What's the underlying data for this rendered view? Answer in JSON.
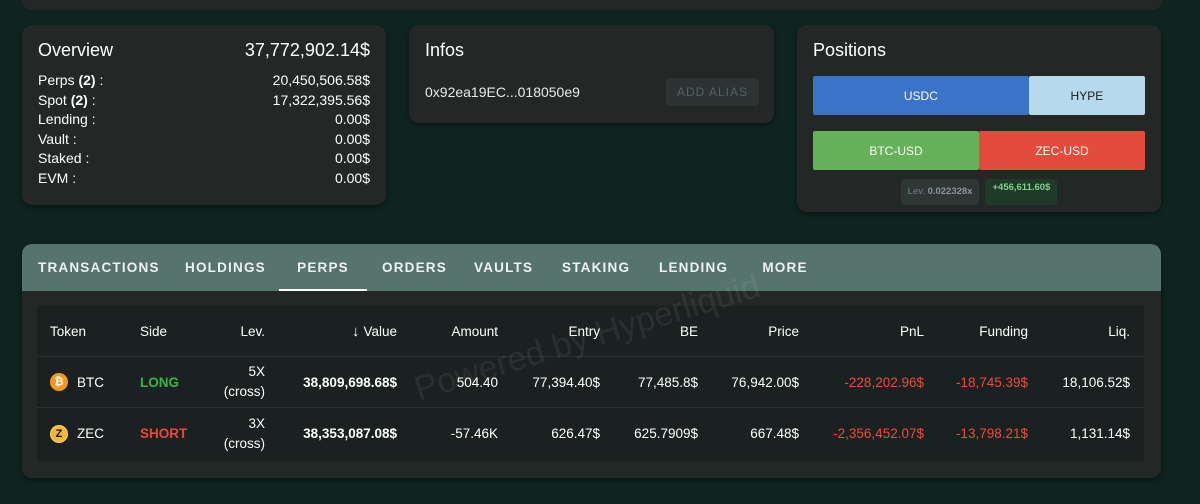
{
  "overview": {
    "title": "Overview",
    "total": "37,772,902.14$",
    "rows": [
      {
        "label": "Perps",
        "count": "(2)",
        "suffix": " :",
        "value": "20,450,506.58$"
      },
      {
        "label": "Spot",
        "count": "(2)",
        "suffix": " :",
        "value": "17,322,395.56$"
      },
      {
        "label": "Lending :",
        "count": "",
        "suffix": "",
        "value": "0.00$"
      },
      {
        "label": "Vault :",
        "count": "",
        "suffix": "",
        "value": "0.00$"
      },
      {
        "label": "Staked :",
        "count": "",
        "suffix": "",
        "value": "0.00$"
      },
      {
        "label": "EVM :",
        "count": "",
        "suffix": "",
        "value": "0.00$"
      }
    ]
  },
  "infos": {
    "title": "Infos",
    "address": "0x92ea19EC...018050e9",
    "add_alias_label": "ADD ALIAS"
  },
  "positions": {
    "title": "Positions",
    "collateral_bar": [
      {
        "label": "USDC",
        "share": 0.65,
        "bg": "#3b73c9",
        "fg": "#ffffff"
      },
      {
        "label": "HYPE",
        "share": 0.35,
        "bg": "#b7d9ec",
        "fg": "#1a1a1a"
      }
    ],
    "side_bar": [
      {
        "label": "BTC-USD",
        "share": 0.5,
        "bg": "#66b25a",
        "fg": "#ffffff"
      },
      {
        "label": "ZEC-USD",
        "share": 0.5,
        "bg": "#e34b3c",
        "fg": "#ffffff"
      }
    ],
    "leverage_label": "Lev.",
    "leverage_value": "0.022328x",
    "pnl": "+456,611.60$"
  },
  "tabs": [
    "TRANSACTIONS",
    "HOLDINGS",
    "PERPS",
    "ORDERS",
    "VAULTS",
    "STAKING",
    "LENDING",
    "MORE"
  ],
  "active_tab": "PERPS",
  "table": {
    "headers": {
      "token": "Token",
      "side": "Side",
      "lev": "Lev.",
      "value": "Value",
      "amount": "Amount",
      "entry": "Entry",
      "be": "BE",
      "price": "Price",
      "pnl": "PnL",
      "funding": "Funding",
      "liq": "Liq."
    },
    "sort_indicator": "↓",
    "rows": [
      {
        "icon": "bitcoin-icon",
        "icon_glyph": "₿",
        "token": "BTC",
        "side": "LONG",
        "lev": "5X",
        "lev_mode": "(cross)",
        "value": "38,809,698.68$",
        "amount": "504.40",
        "entry": "77,394.40$",
        "be": "77,485.8$",
        "price": "76,942.00$",
        "pnl": "-228,202.96$",
        "funding": "-18,745.39$",
        "liq": "18,106.52$"
      },
      {
        "icon": "zcash-icon",
        "icon_glyph": "Z",
        "token": "ZEC",
        "side": "SHORT",
        "lev": "3X",
        "lev_mode": "(cross)",
        "value": "38,353,087.08$",
        "amount": "-57.46K",
        "entry": "626.47$",
        "be": "625.7909$",
        "price": "667.48$",
        "pnl": "-2,356,452.07$",
        "funding": "-13,798.21$",
        "liq": "1,131.14$"
      }
    ]
  },
  "watermark": "Powered by Hyperliquid",
  "colors": {
    "tabs_bg": "#56746d",
    "long": "#34b54a",
    "short": "#f0453a",
    "negative": "#ef4a3f"
  }
}
